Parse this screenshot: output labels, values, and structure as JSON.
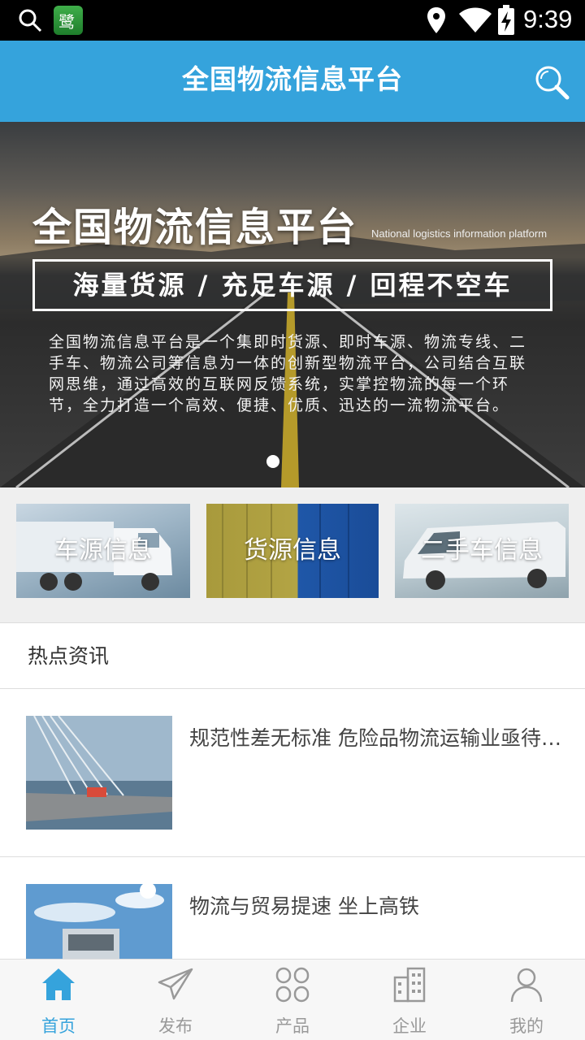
{
  "status_bar": {
    "time": "9:39",
    "app_icon_text": "鹭"
  },
  "header": {
    "title": "全国物流信息平台"
  },
  "banner": {
    "title": "全国物流信息平台",
    "subtitle": "National logistics information platform",
    "slogan": "海量货源 / 充足车源 / 回程不空车",
    "description": "全国物流信息平台是一个集即时货源、即时车源、物流专线、二手车、物流公司等信息为一体的创新型物流平台，公司结合互联网思维，通过高效的互联网反馈系统，实掌控物流的每一个环节，全力打造一个高效、便捷、优质、迅达的一流物流平台。"
  },
  "categories": [
    {
      "label": "车源信息"
    },
    {
      "label": "货源信息"
    },
    {
      "label": "二手车信息"
    }
  ],
  "news": {
    "heading": "热点资讯",
    "items": [
      {
        "title": "规范性差无标准 危险品物流运输业亟待整改"
      },
      {
        "title": "物流与贸易提速 坐上高铁"
      }
    ]
  },
  "tabs": [
    {
      "label": "首页",
      "icon": "home-icon",
      "active": true
    },
    {
      "label": "发布",
      "icon": "send-icon",
      "active": false
    },
    {
      "label": "产品",
      "icon": "grid-icon",
      "active": false
    },
    {
      "label": "企业",
      "icon": "building-icon",
      "active": false
    },
    {
      "label": "我的",
      "icon": "user-icon",
      "active": false
    }
  ],
  "colors": {
    "primary": "#35a3dc",
    "tab_inactive": "#999999"
  }
}
